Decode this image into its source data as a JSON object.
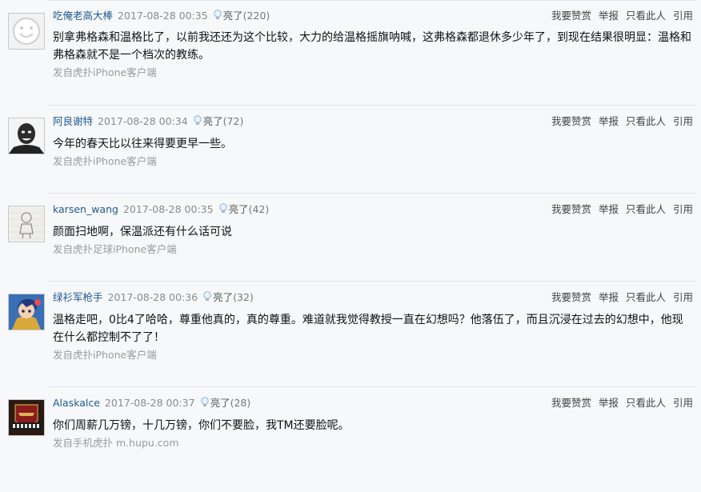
{
  "actions": {
    "reward": "我要赞赏",
    "report": "举报",
    "only_this": "只看此人",
    "quote": "引用"
  },
  "light_label": "亮了",
  "comments": [
    {
      "username": "吃俺老高大棒",
      "time": "2017-08-28 00:35",
      "light_count": "(220)",
      "text": "别拿弗格森和温格比了，以前我还还为这个比较，大力的给温格摇旗呐喊，这弗格森都退休多少年了，到现在结果很明显：温格和弗格森就不是一个档次的教练。",
      "source": "发自虎扑iPhone客户端",
      "avatar_icon": "smiley-face-icon"
    },
    {
      "username": "阿良谢特",
      "time": "2017-08-28 00:34",
      "light_count": "(72)",
      "text": "今年的春天比以往来得要更早一些。",
      "source": "发自虎扑iPhone客户端",
      "avatar_icon": "portrait-icon"
    },
    {
      "username": "karsen_wang",
      "time": "2017-08-28 00:35",
      "light_count": "(42)",
      "text": "颜面扫地啊，保温派还有什么话可说",
      "source": "发自虎扑足球iPhone客户端",
      "avatar_icon": "sketch-doodle-icon"
    },
    {
      "username": "绿衫军枪手",
      "time": "2017-08-28 00:36",
      "light_count": "(32)",
      "text": "温格走吧，0比4了哈哈，尊重他真的，真的尊重。难道就我觉得教授一直在幻想吗？他落伍了，而且沉浸在过去的幻想中，他现在什么都控制不了了！",
      "source": "发自虎扑iPhone客户端",
      "avatar_icon": "anime-character-icon"
    },
    {
      "username": "Alaskalce",
      "time": "2017-08-28 00:37",
      "light_count": "(28)",
      "text": "你们周薪几万镑，十几万镑，你们不要脸，我TM还要脸呢。",
      "source": "发自手机虎扑 m.hupu.com",
      "avatar_icon": "gunners-badge-icon"
    }
  ]
}
